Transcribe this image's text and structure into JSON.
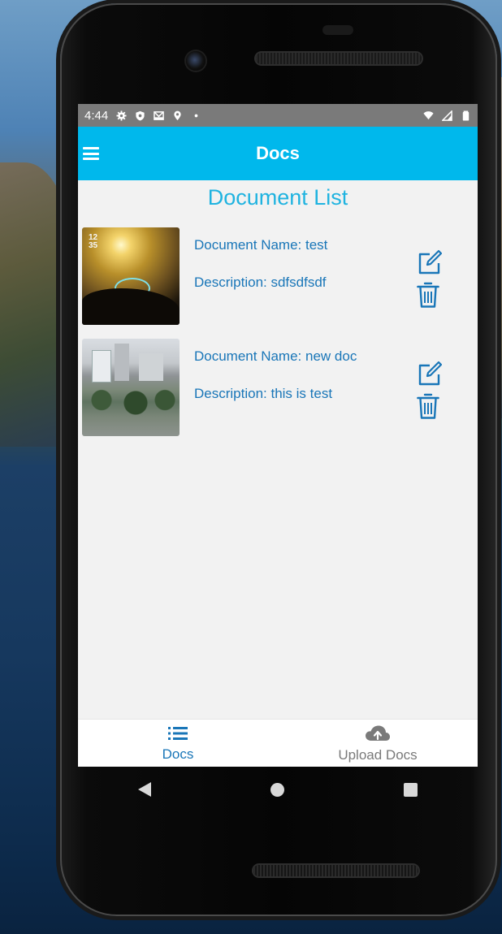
{
  "status_bar": {
    "time": "4:44",
    "left_icons": [
      "gear-icon",
      "shield-icon",
      "mail-icon",
      "location-icon",
      "dot-icon"
    ],
    "right_icons": [
      "wifi-icon",
      "signal-icon",
      "battery-icon"
    ]
  },
  "app_bar": {
    "title": "Docs",
    "menu_icon": "hamburger-menu-icon"
  },
  "list": {
    "title": "Document List",
    "documents": [
      {
        "name": "Document Name: test",
        "description": "Description: sdfsdfsdf"
      },
      {
        "name": "Document Name: new doc",
        "description": "Description: this is test"
      }
    ]
  },
  "bottom_nav": {
    "items": [
      {
        "label": "Docs",
        "icon": "list-icon",
        "active": true
      },
      {
        "label": "Upload Docs",
        "icon": "cloud-upload-icon",
        "active": false
      }
    ]
  },
  "colors": {
    "accent": "#00b8ec",
    "title_text": "#1fb3e0",
    "body_text": "#1976b8",
    "inactive": "#7a7a7a"
  }
}
